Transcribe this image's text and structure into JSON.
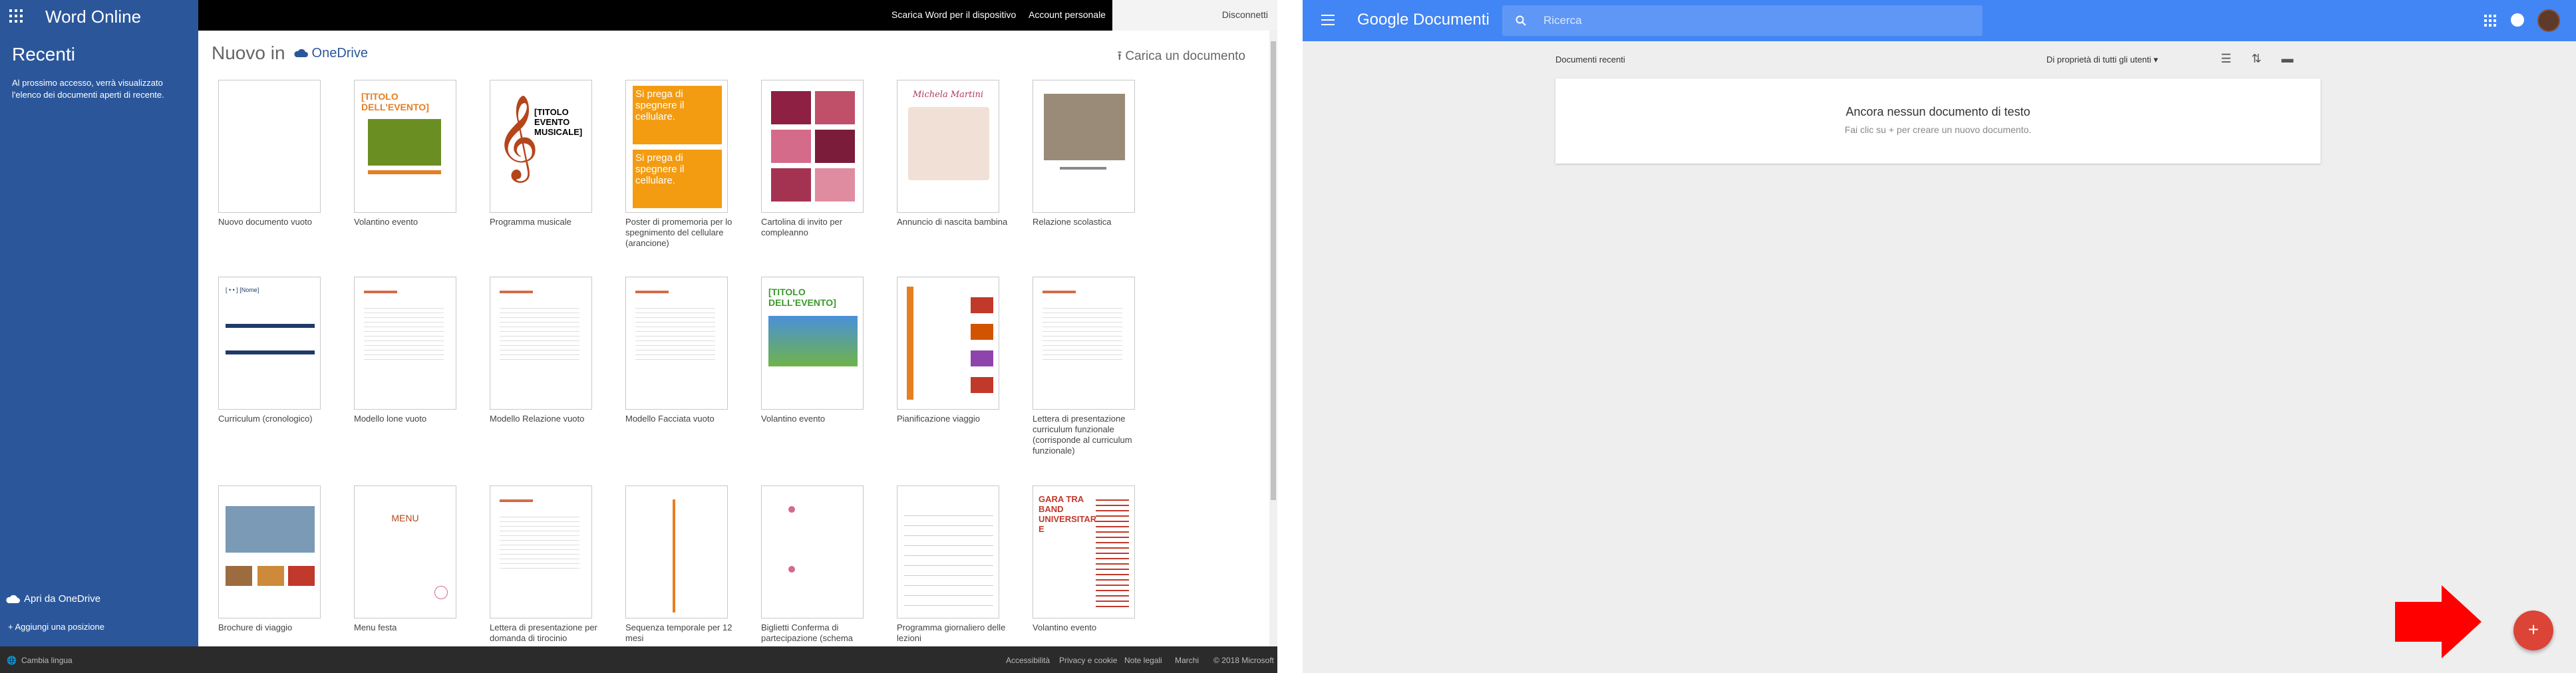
{
  "word": {
    "app_title": "Word Online",
    "topbar": {
      "download": "Scarica Word per il dispositivo",
      "account": "Account personale",
      "disconnect": "Disconnetti"
    },
    "sidebar": {
      "recent_title": "Recenti",
      "recent_desc": "Al prossimo accesso, verrà visualizzato l'elenco dei documenti aperti di recente.",
      "open_onedrive": "Apri da OneDrive",
      "add_place": "Aggiungi una posizione"
    },
    "main": {
      "new_in": "Nuovo in",
      "onedrive": "OneDrive",
      "upload": "Carica un documento",
      "templates": [
        {
          "label": "Nuovo documento vuoto",
          "icon": "blank"
        },
        {
          "label": "Volantino evento",
          "icon": "event-flyer"
        },
        {
          "label": "Programma musicale",
          "icon": "music"
        },
        {
          "label": "Poster di promemoria per lo spegnimento del cellulare (arancione)",
          "icon": "poster",
          "text": "Si prega di spegnere il cellulare."
        },
        {
          "label": "Cartolina di invito per compleanno",
          "icon": "photos"
        },
        {
          "label": "Annuncio di nascita bambina",
          "icon": "baby"
        },
        {
          "label": "Relazione scolastica",
          "icon": "report"
        },
        {
          "label": "Curriculum (cronologico)",
          "icon": "cv"
        },
        {
          "label": "Modello lone vuoto",
          "icon": "doc"
        },
        {
          "label": "Modello Relazione vuoto",
          "icon": "doc"
        },
        {
          "label": "Modello Facciata vuoto",
          "icon": "doc"
        },
        {
          "label": "Volantino evento",
          "icon": "wind"
        },
        {
          "label": "Pianificazione viaggio",
          "icon": "travel"
        },
        {
          "label": "Lettera di presentazione curriculum funzionale (corrisponde al curriculum funzionale)",
          "icon": "letter"
        },
        {
          "label": "Brochure di viaggio",
          "icon": "brochure"
        },
        {
          "label": "Menu festa",
          "icon": "menu"
        },
        {
          "label": "Lettera di presentazione per domanda di tirocinio",
          "icon": "letter"
        },
        {
          "label": "Sequenza temporale per 12 mesi",
          "icon": "timeline"
        },
        {
          "label": "Biglietti Conferma di partecipazione (schema",
          "icon": "rsvp"
        },
        {
          "label": "Programma giornaliero delle lezioni",
          "icon": "schedule"
        },
        {
          "label": "Volantino evento",
          "icon": "contest"
        }
      ],
      "thumb_texts": {
        "event_title": "[TITOLO DELL'EVENTO]",
        "music_title": "[TITOLO EVENTO MUSICALE]",
        "contest_title": "GARA TRA BAND UNIVERSITARI E",
        "baby_name": "Michela Martini",
        "menu_title": "MENU"
      }
    },
    "footer": {
      "language": "Cambia lingua",
      "links": [
        "Accessibilità",
        "Privacy e cookie",
        "Note legali",
        "Marchi",
        "© 2018 Microsoft"
      ]
    }
  },
  "gdocs": {
    "app_title": "Google Documenti",
    "search_placeholder": "Ricerca",
    "recent": "Documenti recenti",
    "owner_filter": "Di proprietà di tutti gli utenti",
    "empty_title": "Ancora nessun documento di testo",
    "empty_desc": "Fai clic su + per creare un nuovo documento.",
    "fab": "+"
  },
  "colors": {
    "word_blue": "#2b579a",
    "google_blue": "#4285f4",
    "fab_red": "#db4437",
    "arrow_red": "#ff0000"
  }
}
